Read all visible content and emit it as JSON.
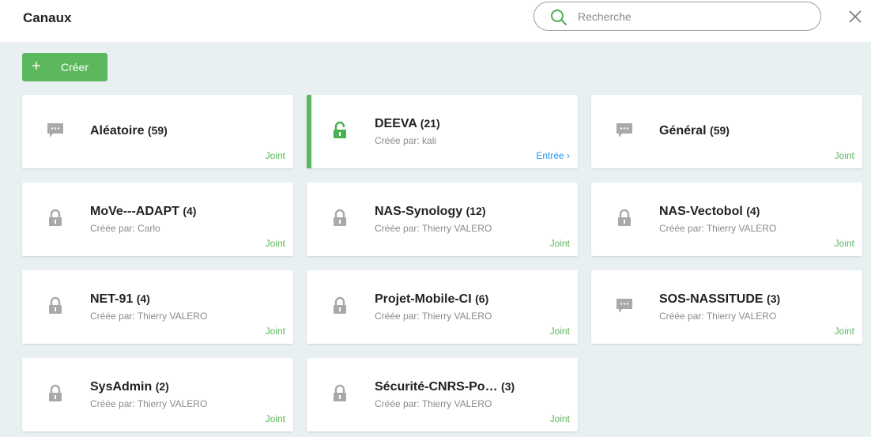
{
  "header": {
    "title": "Canaux",
    "search_placeholder": "Recherche",
    "search_value": ""
  },
  "toolbar": {
    "create_icon": "+",
    "create_label": "Créer"
  },
  "colors": {
    "accent_green": "#5cb85c",
    "link_blue": "#2196f3",
    "background": "#e9f0f2"
  },
  "channels": [
    {
      "name": "Aléatoire",
      "count": "(59)",
      "creator": "",
      "status": "Joint",
      "icon": "chat-icon"
    },
    {
      "name": "DEEVA",
      "count": "(21)",
      "creator": "Créée par: kali",
      "status": "Entrée ›",
      "icon": "lock-icon",
      "active": true
    },
    {
      "name": "Général",
      "count": "(59)",
      "creator": "",
      "status": "Joint",
      "icon": "chat-icon"
    },
    {
      "name": "MoVe---ADAPT",
      "count": "(4)",
      "creator": "Créée par: Carlo",
      "status": "Joint",
      "icon": "lock-icon"
    },
    {
      "name": "NAS-Synology",
      "count": "(12)",
      "creator": "Créée par: Thierry VALERO",
      "status": "Joint",
      "icon": "lock-icon"
    },
    {
      "name": "NAS-Vectobol",
      "count": "(4)",
      "creator": "Créée par: Thierry VALERO",
      "status": "Joint",
      "icon": "lock-icon"
    },
    {
      "name": "NET-91",
      "count": "(4)",
      "creator": "Créée par: Thierry VALERO",
      "status": "Joint",
      "icon": "lock-icon"
    },
    {
      "name": "Projet-Mobile-CI",
      "count": "(6)",
      "creator": "Créée par: Thierry VALERO",
      "status": "Joint",
      "icon": "lock-icon"
    },
    {
      "name": "SOS-NASSITUDE",
      "count": "(3)",
      "creator": "Créée par: Thierry VALERO",
      "status": "Joint",
      "icon": "chat-icon"
    },
    {
      "name": "SysAdmin",
      "count": "(2)",
      "creator": "Créée par: Thierry VALERO",
      "status": "Joint",
      "icon": "lock-icon"
    },
    {
      "name": "Sécurité-CNRS-Po…",
      "count": "(3)",
      "creator": "Créée par: Thierry VALERO",
      "status": "Joint",
      "icon": "lock-icon"
    }
  ]
}
